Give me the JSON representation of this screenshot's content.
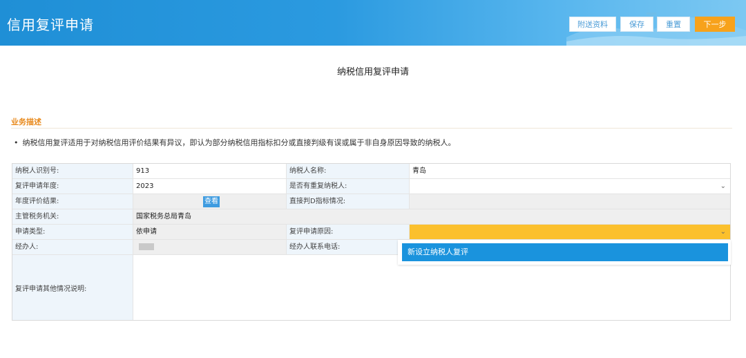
{
  "header": {
    "title": "信用复评申请",
    "buttons": {
      "attach": "附送资料",
      "save": "保存",
      "reset": "重置",
      "next": "下一步"
    }
  },
  "page": {
    "title": "纳税信用复评申请"
  },
  "section": {
    "label": "业务描述",
    "description": "纳税信用复评适用于对纳税信用评价结果有异议，即认为部分纳税信用指标扣分或直接判级有误或属于非自身原因导致的纳税人。",
    "bullet": "•"
  },
  "form": {
    "taxpayer_id": {
      "label": "纳税人识别号:",
      "value": "913"
    },
    "taxpayer_name": {
      "label": "纳税人名称:",
      "value": "青岛"
    },
    "review_year": {
      "label": "复评申请年度:",
      "value": "2023"
    },
    "reorganized": {
      "label": "是否有重复纳税人:",
      "value": ""
    },
    "annual_result": {
      "label": "年度评价结果:",
      "view_button": "查看"
    },
    "direct_d": {
      "label": "直接判D指标情况:",
      "value": ""
    },
    "tax_authority": {
      "label": "主管税务机关:",
      "value": "国家税务总局青岛"
    },
    "apply_type": {
      "label": "申请类型:",
      "value": "依申请"
    },
    "apply_reason": {
      "label": "复评申请原因:",
      "value": ""
    },
    "handler": {
      "label": "经办人:",
      "value": ""
    },
    "handler_phone": {
      "label": "经办人联系电话:",
      "value": ""
    },
    "remark": {
      "label": "复评申请其他情况说明:",
      "value": ""
    }
  },
  "dropdown": {
    "options": [
      "新设立纳税人复评"
    ]
  },
  "colors": {
    "header_blue": "#1f8fd6",
    "next_orange": "#f7a21b",
    "section_orange": "#e8891b",
    "dropdown_selected": "#1a93dd",
    "reason_yellow": "#fbc02d"
  }
}
